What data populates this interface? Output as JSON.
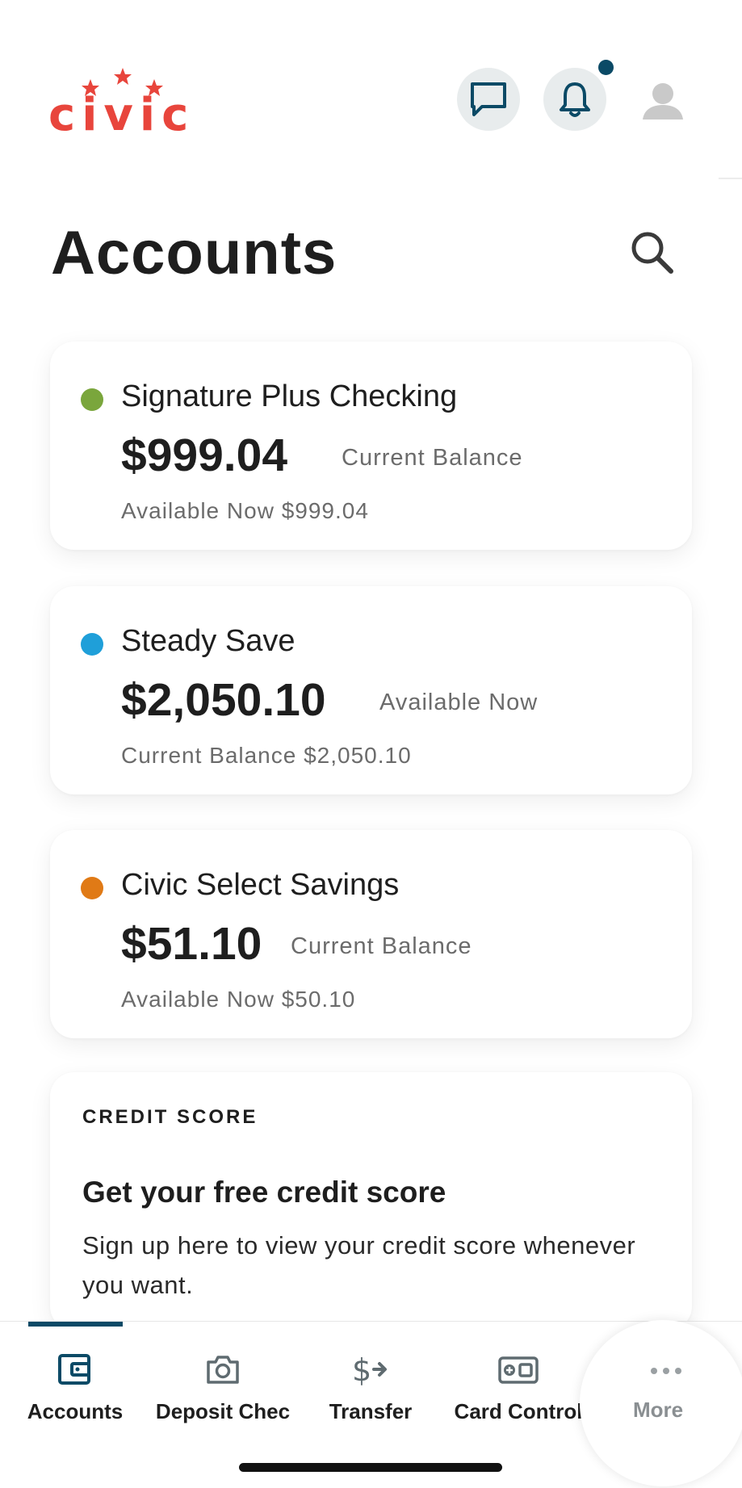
{
  "header": {
    "logo_text": "civic",
    "chat_icon": "chat-bubble-icon",
    "bell_icon": "bell-icon",
    "profile_icon": "person-icon",
    "brand_color": "#e8453c",
    "accent_color": "#0b4a66"
  },
  "page": {
    "title": "Accounts",
    "search_icon": "search-icon"
  },
  "accounts": [
    {
      "name": "Signature Plus Checking",
      "amount": "$999.04",
      "amount_label": "Current Balance",
      "sub": "Available Now $999.04",
      "dot_color": "#7aa63c"
    },
    {
      "name": "Steady Save",
      "amount": "$2,050.10",
      "amount_label": "Available Now",
      "sub": "Current Balance $2,050.10",
      "dot_color": "#1f9fd9"
    },
    {
      "name": "Civic Select Savings",
      "amount": "$51.10",
      "amount_label": "Current Balance",
      "sub": "Available Now $50.10",
      "dot_color": "#e07a16"
    }
  ],
  "credit_score": {
    "eyebrow": "CREDIT SCORE",
    "title": "Get your free credit score",
    "body": "Sign up here to view your credit score whenever you want."
  },
  "bottom_nav": {
    "items": [
      {
        "label": "Accounts",
        "icon": "wallet-icon",
        "active": true
      },
      {
        "label": "Deposit Chec",
        "icon": "camera-icon",
        "active": false
      },
      {
        "label": "Transfer",
        "icon": "dollar-arrow-icon",
        "active": false
      },
      {
        "label": "Card Control",
        "icon": "card-control-icon",
        "active": false
      },
      {
        "label": "More",
        "icon": "ellipsis-icon",
        "active": false
      }
    ]
  }
}
